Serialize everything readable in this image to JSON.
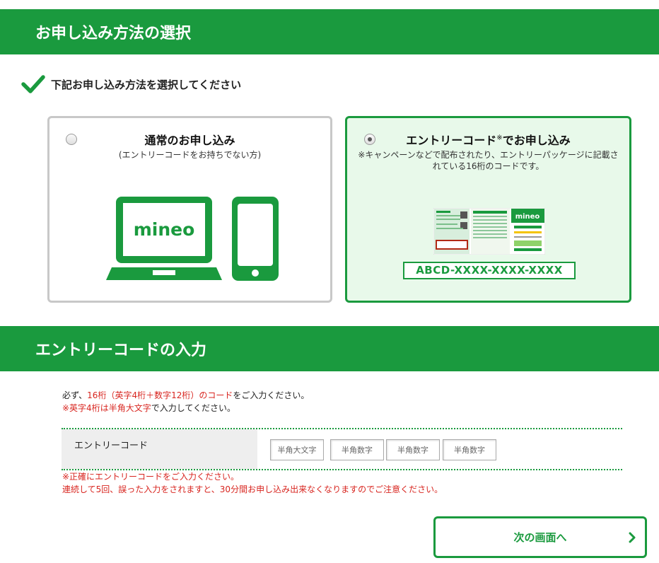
{
  "section1": {
    "title": "お申し込み方法の選択"
  },
  "instruction": "下記お申し込み方法を選択してください",
  "option_normal": {
    "title": "通常のお申し込み",
    "subtitle": "(エントリーコードをお持ちでない方)",
    "selected": false,
    "logo_text": "mineo"
  },
  "option_entry": {
    "title_main": "エントリーコード",
    "title_mark": "※",
    "title_suffix": "でお申し込み",
    "description": "※キャンペーンなどで配布されたり、エントリーパッケージに記載されている16桁のコードです。",
    "selected": true,
    "package_logo": "mineo",
    "code_sample": "ABCD-XXXX-XXXX-XXXX"
  },
  "section2": {
    "title": "エントリーコードの入力"
  },
  "note_top": {
    "line1_prefix": "必ず、",
    "line1_red": "16桁（英字4桁＋数字12桁）のコード",
    "line1_suffix": "をご入力ください。",
    "line2_red": "※英字4桁は半角大文字",
    "line2_suffix": "で入力してください。"
  },
  "form": {
    "label": "エントリーコード",
    "inputs": [
      {
        "placeholder": "半角大文字",
        "value": ""
      },
      {
        "placeholder": "半角数字",
        "value": ""
      },
      {
        "placeholder": "半角数字",
        "value": ""
      },
      {
        "placeholder": "半角数字",
        "value": ""
      }
    ]
  },
  "note_bottom": {
    "line1": "※正確にエントリーコードをご入力ください。",
    "line2": "連続して5回、誤った入力をされますと、30分間お申し込み出来なくなりますのでご注意ください。"
  },
  "next_button": {
    "label": "次の画面へ",
    "icon": "chevron-right-icon"
  },
  "colors": {
    "brand_green": "#1a9a3e",
    "selected_bg": "#e8f9ea",
    "warning_red": "#d8251f"
  }
}
